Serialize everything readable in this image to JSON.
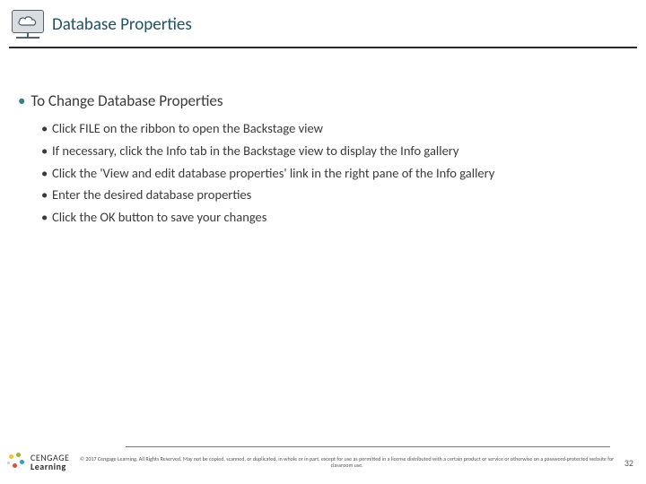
{
  "header": {
    "title": "Database Properties"
  },
  "content": {
    "heading": "To Change Database Properties",
    "bullets": [
      "Click FILE on the ribbon to open the Backstage view",
      "If necessary, click the Info tab in the Backstage view to display the Info gallery",
      "Click the 'View and edit database properties' link in the right pane of the Info gallery",
      "Enter the desired database properties",
      "Click the OK button to save your changes"
    ]
  },
  "footer": {
    "logo_line1": "CENGAGE",
    "logo_line2": "Learning",
    "copyright": "© 2017 Cengage Learning. All Rights Reserved. May not be copied, scanned, or duplicated, in whole or in part, except for use as permitted in a license distributed with a certain product or service or otherwise on a password-protected website for classroom use.",
    "page": "32"
  }
}
